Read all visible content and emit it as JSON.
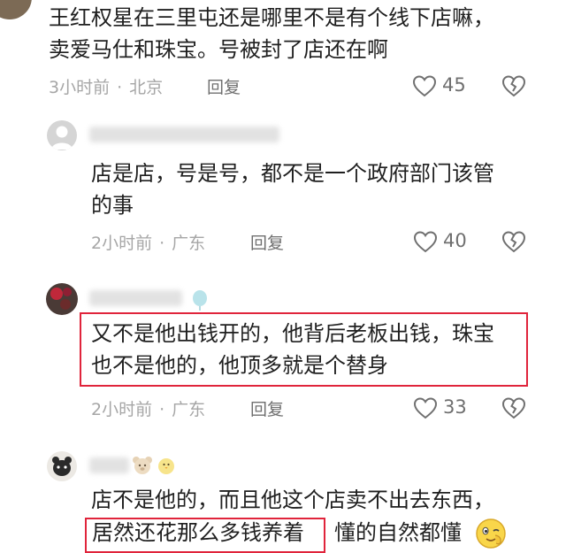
{
  "comments": [
    {
      "lines": [
        "王红权星在三里屯还是哪里不是有个线下店嘛，",
        "卖爱马仕和珠宝。号被封了店还在啊"
      ],
      "time": "3小时前",
      "location": "北京",
      "reply_label": "回复",
      "likes": "45"
    },
    {
      "lines": [
        "店是店，号是号，都不是一个政府部门该管",
        "的事"
      ],
      "time": "2小时前",
      "location": "广东",
      "reply_label": "回复",
      "likes": "40"
    },
    {
      "lines": [
        "又不是他出钱开的，他背后老板出钱，珠宝",
        "也不是他的，他顶多就是个替身"
      ],
      "time": "2小时前",
      "location": "广东",
      "reply_label": "回复",
      "likes": "33"
    },
    {
      "lines": [
        "店不是他的，而且他这个店卖不出去东西，",
        "居然还花那么多钱养着",
        "懂的自然都懂"
      ]
    }
  ],
  "icons": {
    "like": "heart-outline-icon",
    "dislike": "broken-heart-icon",
    "badge": "balloon-icon",
    "bear": "bear-emoji-icon",
    "chick": "chick-emoji-icon",
    "wink": "wink-emoji-icon"
  },
  "colors": {
    "highlight_box": "#e0243b",
    "meta_text": "#a6a6a6",
    "body_text": "#1f1f1f"
  }
}
